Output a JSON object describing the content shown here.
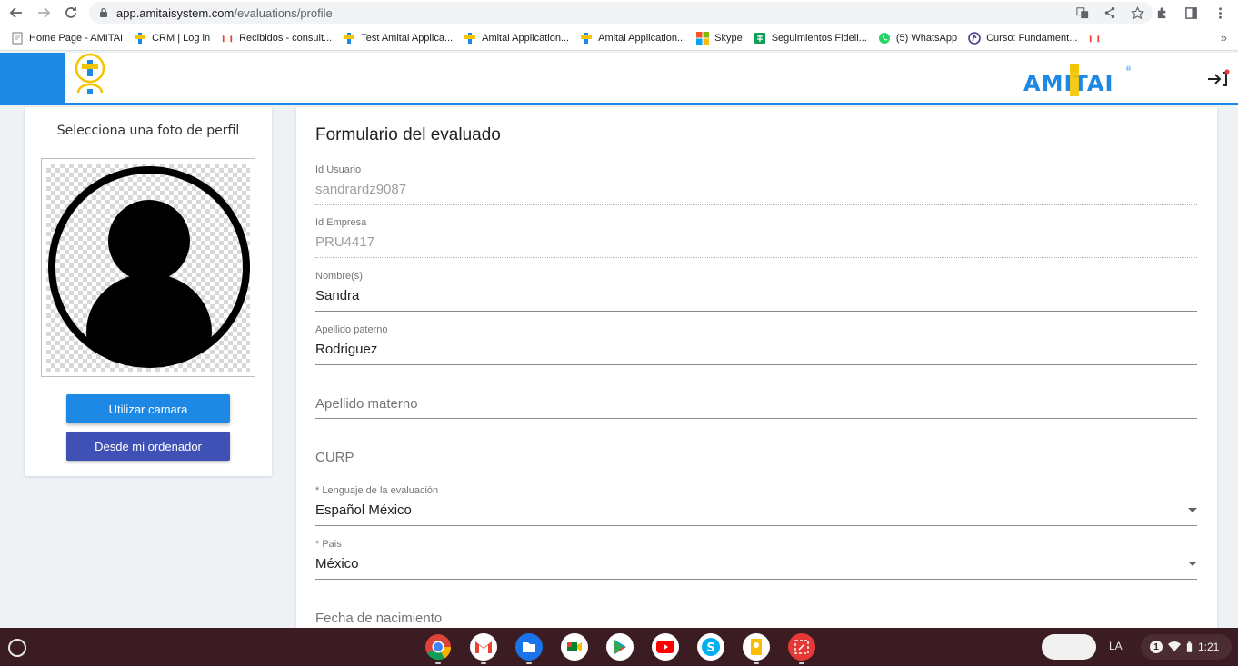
{
  "browser": {
    "url_host": "app.amitaisystem.com",
    "url_path": "/evaluations/profile",
    "bookmarks": [
      {
        "label": "Home Page - AMITAI",
        "icon": "page-icon"
      },
      {
        "label": "CRM | Log in",
        "icon": "amitai-icon"
      },
      {
        "label": "Recibidos - consult...",
        "icon": "gmail-icon"
      },
      {
        "label": "Test Amitai Applica...",
        "icon": "amitai-icon"
      },
      {
        "label": "Amitai Application...",
        "icon": "amitai-icon"
      },
      {
        "label": "Amitai Application...",
        "icon": "amitai-icon"
      },
      {
        "label": "Skype",
        "icon": "microsoft-icon"
      },
      {
        "label": "Seguimientos Fideli...",
        "icon": "sheets-icon"
      },
      {
        "label": "(5) WhatsApp",
        "icon": "whatsapp-icon"
      },
      {
        "label": "Curso: Fundament...",
        "icon": "course-icon"
      },
      {
        "label": "",
        "icon": "gmail-icon"
      }
    ],
    "more_label": "»"
  },
  "header": {
    "brand": "AMITAI"
  },
  "photo": {
    "title": "Selecciona una foto de perfil",
    "camera_button": "Utilizar camara",
    "computer_button": "Desde mi ordenador"
  },
  "form": {
    "title": "Formulario del evaluado",
    "fields": [
      {
        "label": "Id Usuario",
        "value": "sandrardz9087",
        "state": "disabled"
      },
      {
        "label": "Id Empresa",
        "value": "PRU4417",
        "state": "disabled"
      },
      {
        "label": "Nombre(s)",
        "value": "Sandra",
        "state": "filled"
      },
      {
        "label": "Apellido paterno",
        "value": "Rodriguez",
        "state": "filled"
      },
      {
        "label": "",
        "placeholder": "Apellido materno",
        "state": "empty"
      },
      {
        "label": "",
        "placeholder": "CURP",
        "state": "empty"
      },
      {
        "label": "* Lenguaje de la evaluación",
        "value": "Español México",
        "state": "select"
      },
      {
        "label": "* Pais",
        "value": "México",
        "state": "select"
      },
      {
        "label": "",
        "placeholder": "Fecha de nacimiento",
        "state": "empty"
      }
    ]
  },
  "taskbar": {
    "apps": [
      "chrome-icon",
      "gmail-icon",
      "files-icon",
      "meet-icon",
      "play-store-icon",
      "youtube-icon",
      "skype-icon",
      "keep-icon",
      "screencast-icon"
    ],
    "ime": "LA",
    "notification_count": "1",
    "time": "1:21"
  },
  "colors": {
    "primary": "#1e88e5",
    "indigo": "#3f51b5",
    "taskbar": "#3a1c22"
  }
}
